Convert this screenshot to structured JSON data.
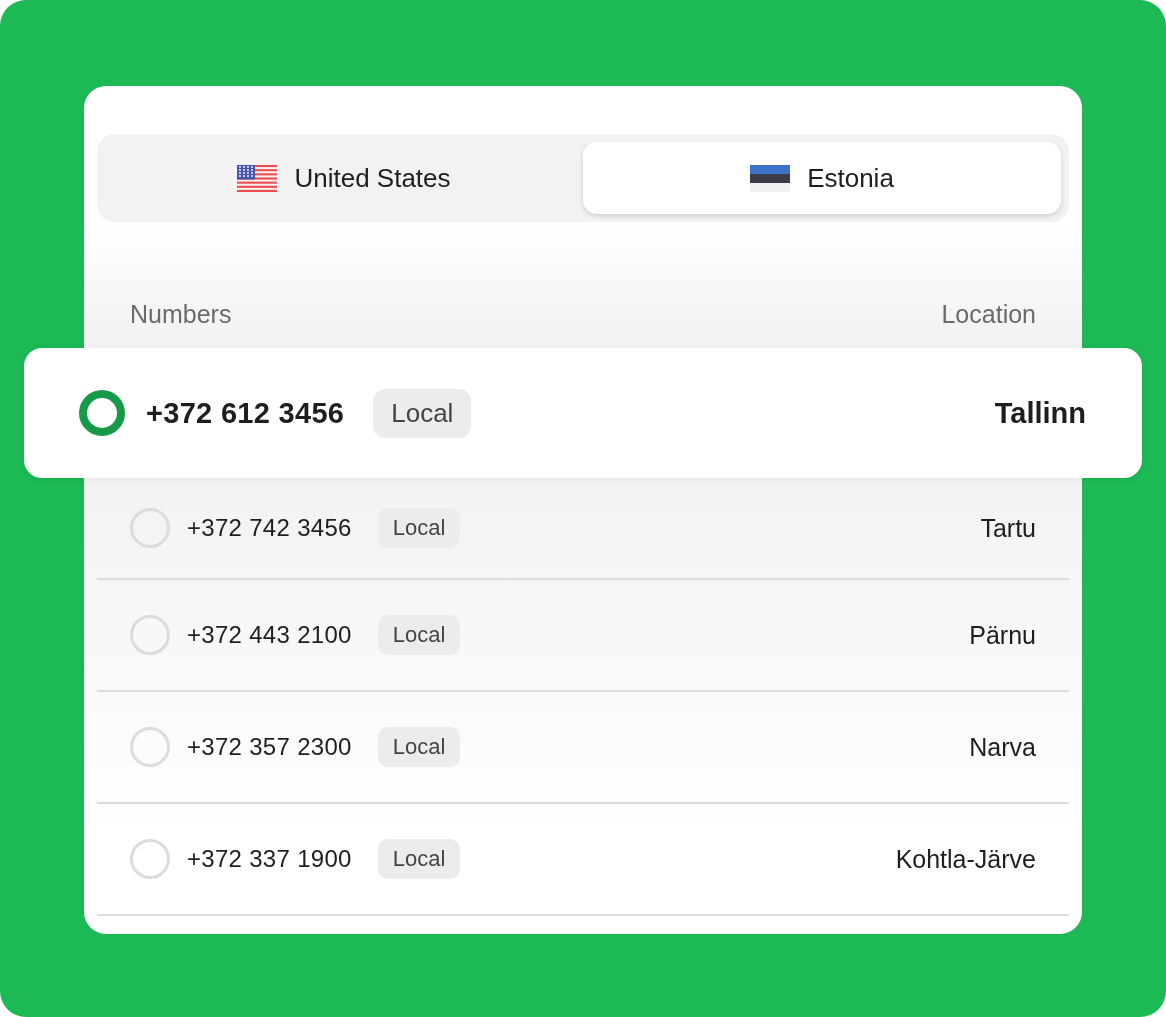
{
  "tabs": [
    {
      "label": "United States",
      "selected": false
    },
    {
      "label": "Estonia",
      "selected": true
    }
  ],
  "table": {
    "columns": [
      "Numbers",
      "Location"
    ],
    "rows": [
      {
        "number": "+372 612 3456",
        "tag": "Local",
        "location": "Tallinn",
        "selected": true
      },
      {
        "number": "+372 742 3456",
        "tag": "Local",
        "location": "Tartu",
        "selected": false
      },
      {
        "number": "+372 443 2100",
        "tag": "Local",
        "location": "Pärnu",
        "selected": false
      },
      {
        "number": "+372 357 2300",
        "tag": "Local",
        "location": "Narva",
        "selected": false
      },
      {
        "number": "+372 337 1900",
        "tag": "Local",
        "location": "Kohtla-Järve",
        "selected": false
      }
    ]
  }
}
